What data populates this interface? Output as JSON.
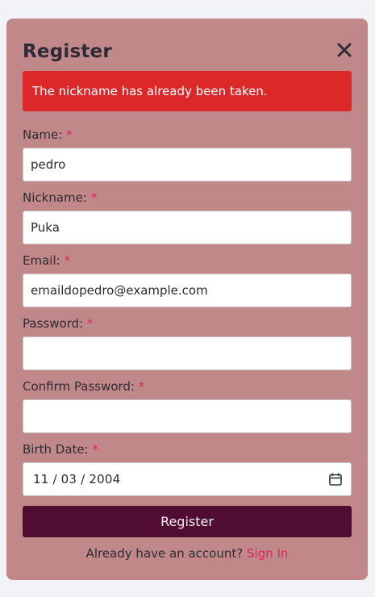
{
  "form": {
    "title": "Register",
    "error": "The nickname has already been taken.",
    "required_mark": "*",
    "fields": {
      "name": {
        "label": "Name:",
        "value": "pedro"
      },
      "nickname": {
        "label": "Nickname:",
        "value": "Puka"
      },
      "email": {
        "label": "Email:",
        "value": "emaildopedro@example.com"
      },
      "password": {
        "label": "Password:",
        "value": ""
      },
      "confirm_password": {
        "label": "Confirm Password:",
        "value": ""
      },
      "birth_date": {
        "label": "Birth Date:",
        "value": "11 / 03 / 2004"
      }
    },
    "submit_label": "Register",
    "footer_text": "Already have an account?",
    "signin_label": "Sign In"
  },
  "colors": {
    "card": "#c08888",
    "error": "#dc2828",
    "button": "#510d31",
    "accent": "#e0245e"
  },
  "icons": {
    "close": "close-icon",
    "calendar": "calendar-icon"
  }
}
